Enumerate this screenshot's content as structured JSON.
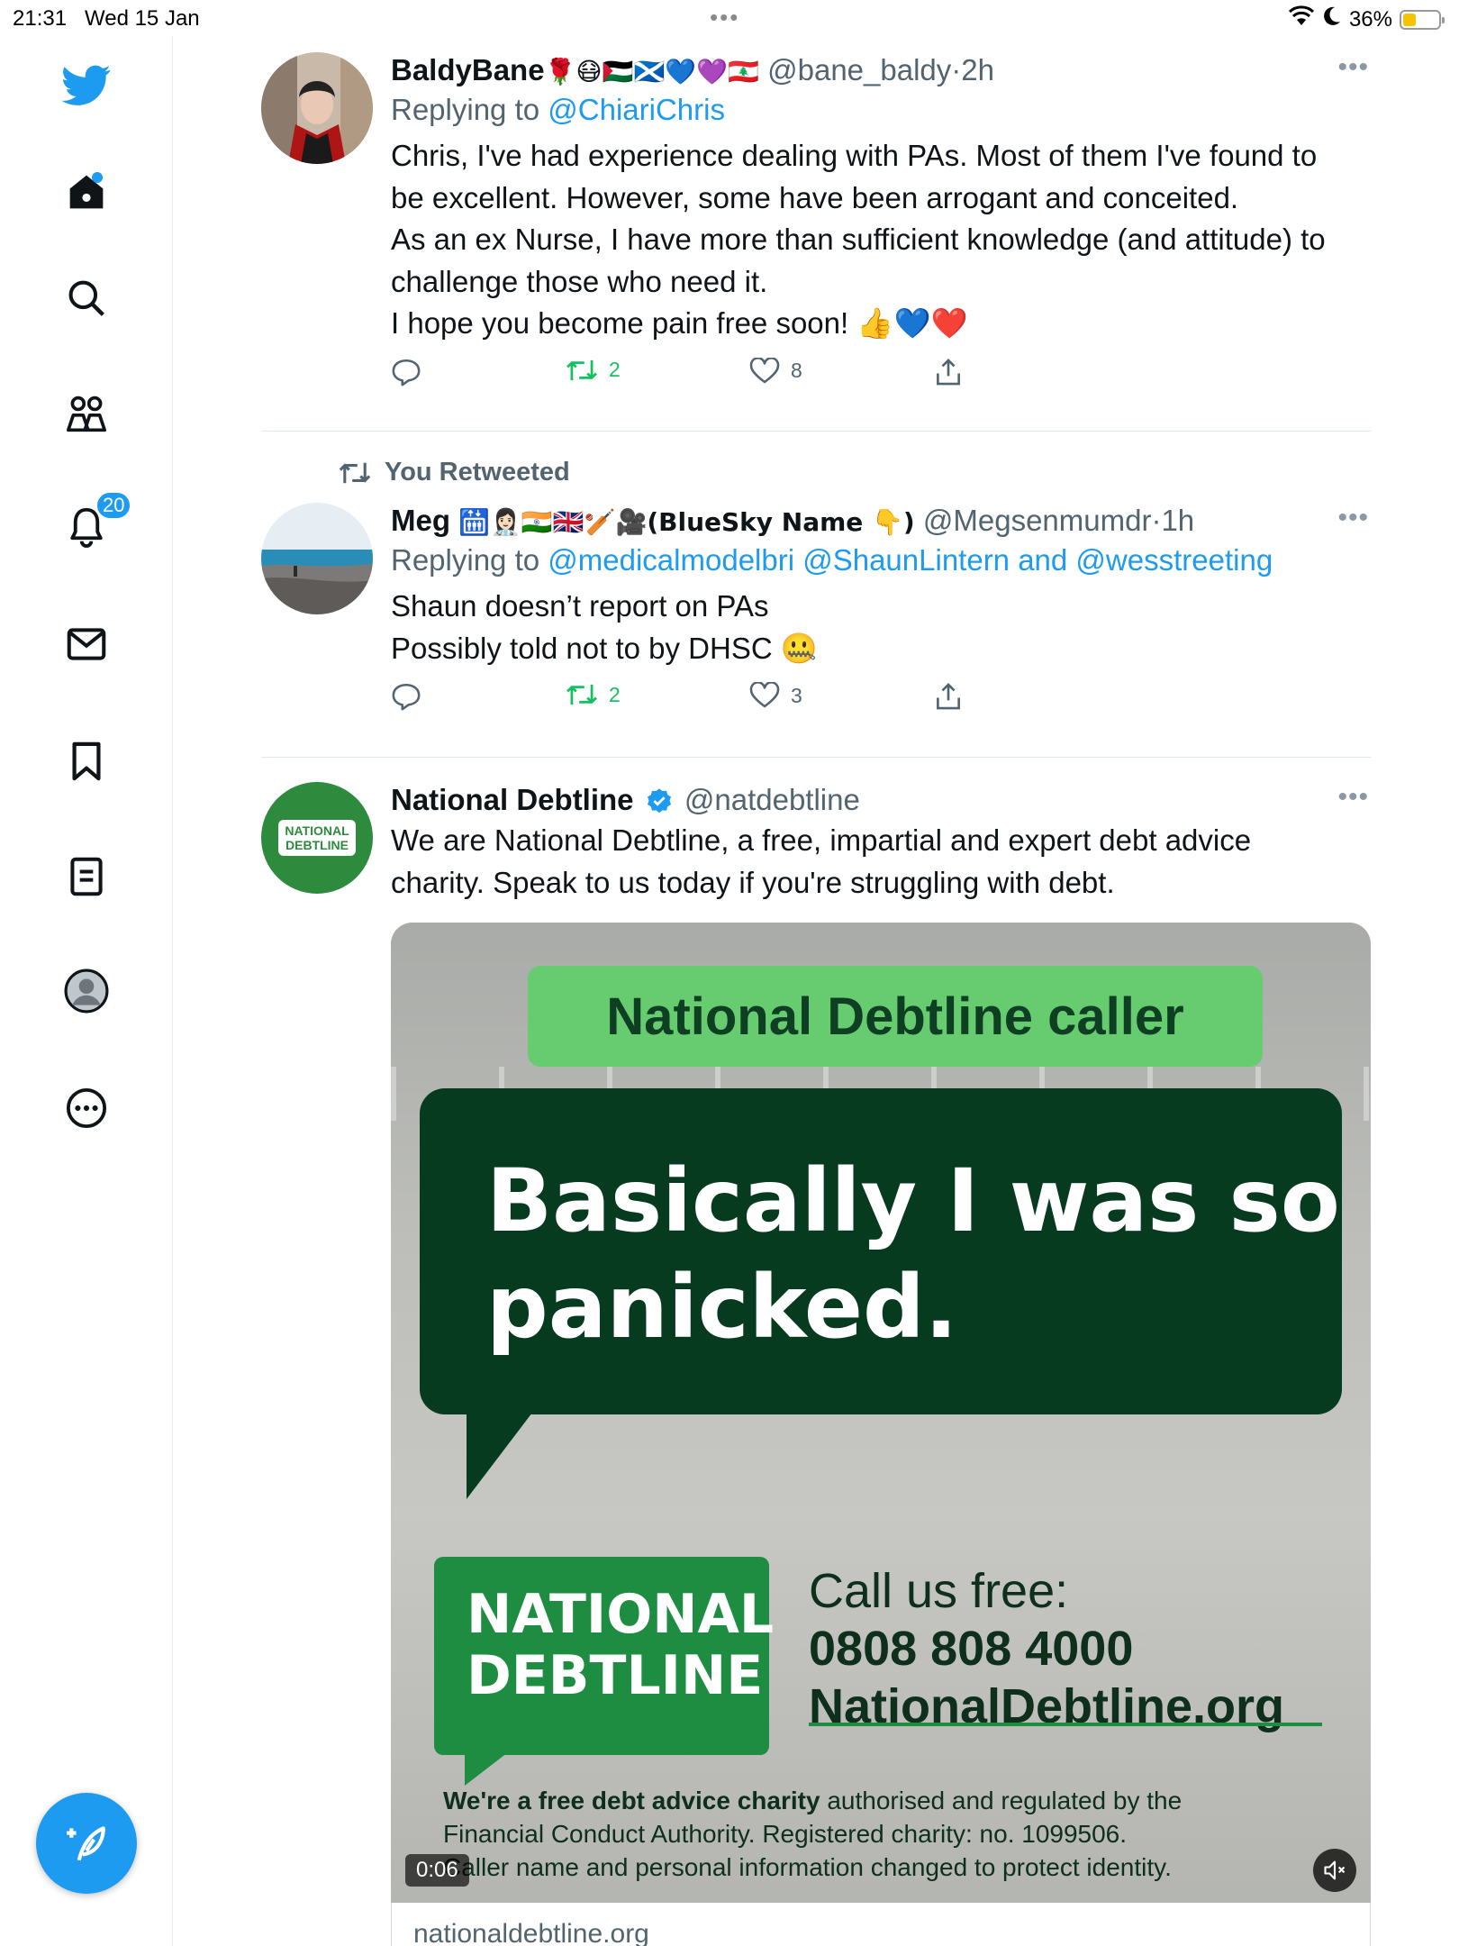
{
  "status_bar": {
    "time": "21:31",
    "date": "Wed 15 Jan",
    "battery": "36%",
    "battery_level": 0.36
  },
  "sidebar": {
    "items": [
      {
        "icon": "home-icon"
      },
      {
        "icon": "search-icon"
      },
      {
        "icon": "communities-icon"
      },
      {
        "icon": "notifications-icon",
        "badge": "20"
      },
      {
        "icon": "messages-icon"
      },
      {
        "icon": "bookmarks-icon"
      },
      {
        "icon": "lists-icon"
      },
      {
        "icon": "profile-icon"
      },
      {
        "icon": "more-icon"
      }
    ],
    "compose_icon": "compose-tweet-icon"
  },
  "tweets": [
    {
      "name": "BaldyBane",
      "name_emoji": "🌹😷🇵🇸🏴󠁧󠁢󠁳󠁣󠁴󠁿💙💜🇱🇧",
      "handle": "@bane_baldy",
      "time": "2h",
      "replying_label": "Replying to",
      "replying_to": "@ChiariChris",
      "lines": [
        "Chris, I've had experience dealing with PAs. Most of them I've found to",
        "be excellent. However, some have been arrogant and conceited.",
        "As an ex Nurse, I have more than sufficient knowledge (and attitude) to",
        "challenge those who need it.",
        "I hope you become pain free soon! 👍💙❤️"
      ],
      "retweets": "2",
      "likes": "8"
    },
    {
      "retweeted_label": "You Retweeted",
      "name": "Meg",
      "name_emoji": "🛗👩🏻‍⚕️🇮🇳🇬🇧🏏🎥(BlueSky Name 👇)",
      "handle": "@Megsenmumdr",
      "time": "1h",
      "replying_label": "Replying to",
      "replying_to": "@medicalmodelbri @ShaunLintern and @wesstreeting",
      "lines": [
        "Shaun doesn’t report on PAs",
        "Possibly told not to by DHSC 🤐"
      ],
      "retweets": "2",
      "likes": "3"
    },
    {
      "name": "National Debtline",
      "handle": "@natdebtline",
      "avatar_text": "NATIONAL DEBTLINE",
      "lines": [
        "We are National Debtline, a free, impartial and expert debt advice",
        "charity. Speak to us today if you're struggling with debt."
      ],
      "media": {
        "caller_label": "National Debtline caller",
        "quote_line1": "Basically I was so",
        "quote_line2": "panicked.",
        "logo_line1": "NATIONAL",
        "logo_line2": "DEBTLINE",
        "call_label": "Call us free:",
        "phone": "0808 808 4000",
        "website": "NationalDebtline.org",
        "disclaimer_bold": "We're a free debt advice charity",
        "disclaimer_rest": " authorised and regulated by the",
        "disclaimer_line2": "Financial Conduct Authority. Registered charity: no. 1099506.",
        "disclaimer_line3": "Caller name and personal information changed to protect identity.",
        "duration": "0:06"
      },
      "link_domain": "nationaldebtline.org"
    }
  ],
  "colors": {
    "accent": "#1d9bf0",
    "retweet_green": "#17bf63",
    "debtline_green": "#1e8d41",
    "bubble_green": "#063b1f"
  }
}
